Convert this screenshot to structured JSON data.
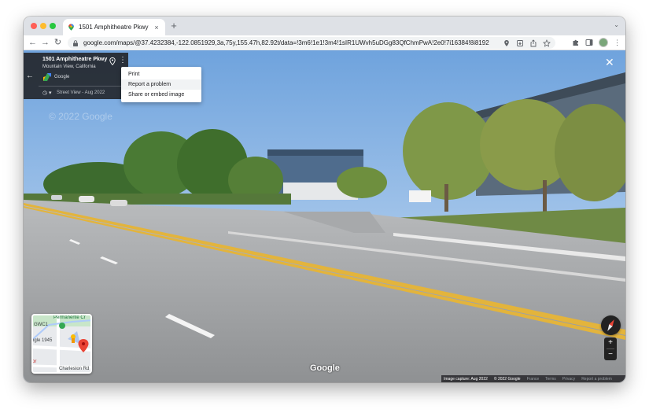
{
  "browser": {
    "tab_title": "1501 Amphitheatre Pkwy - Goo",
    "tab_close": "×",
    "new_tab": "+",
    "tab_search": "⌄",
    "url": "google.com/maps/@37.4232384,-122.0851929,3a,75y,155.47h,82.92t/data=!3m6!1e1!3m4!1sIR1UWvh5uDGg83QfChmPwA!2e0!7i16384!8i8192",
    "nav": {
      "back": "←",
      "forward": "→",
      "reload": "↻"
    },
    "colors": {
      "traffic_red": "#ff5f57",
      "traffic_yellow": "#febc2e",
      "traffic_green": "#28c840"
    }
  },
  "info_card": {
    "address": "1501 Amphitheatre Pkwy",
    "city": "Mountain View, California",
    "contributor": "Google",
    "streetview_date": "Street View - Aug 2022",
    "back_icon": "←",
    "menu_icon": "⋮",
    "clock_icon": "◷ ▾"
  },
  "menu": {
    "items": [
      "Print",
      "Report a problem",
      "Share or embed image"
    ],
    "highlighted_index": 1
  },
  "close_label": "✕",
  "minimap": {
    "labels": {
      "permanente": "Permanente Cr",
      "gwc1": "GWC1",
      "ogle": "ogle 1945",
      "charleston": "Charleston Rd",
      "or": "or"
    }
  },
  "controls": {
    "zoom_in": "+",
    "zoom_out": "−"
  },
  "watermark": "Google",
  "footer": {
    "capture": "Image capture: Aug 2022",
    "copyright": "© 2022 Google",
    "country": "France",
    "terms": "Terms",
    "privacy": "Privacy",
    "report": "Report a problem"
  }
}
